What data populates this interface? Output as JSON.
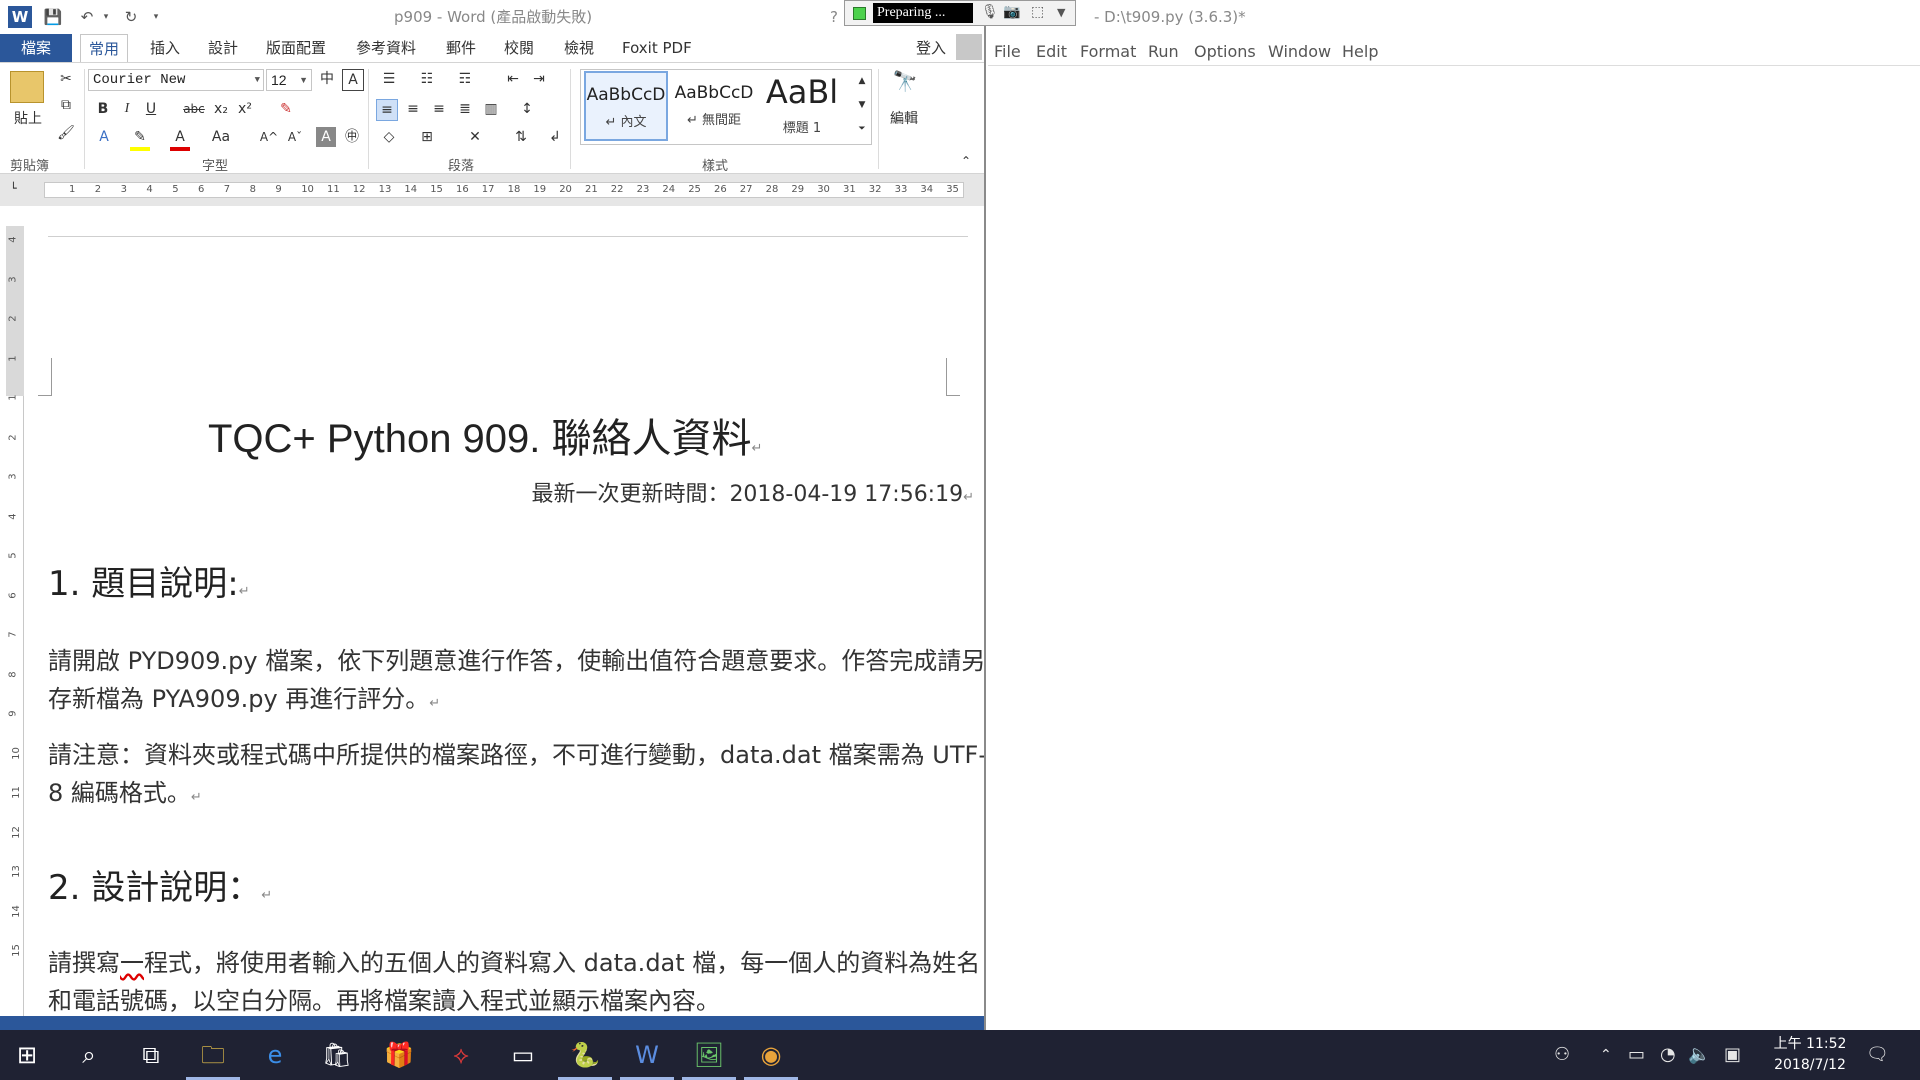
{
  "word": {
    "window_title": "p909 - Word (產品啟動失敗)",
    "help_glyph": "?",
    "tabs": [
      "檔案",
      "常用",
      "插入",
      "設計",
      "版面配置",
      "參考資料",
      "郵件",
      "校閱",
      "檢視",
      "Foxit PDF"
    ],
    "signin": "登入",
    "ribbon": {
      "paste_label": "貼上",
      "clipboard_label": "剪貼簿",
      "font_label": "字型",
      "paragraph_label": "段落",
      "styles_label": "樣式",
      "editing_label": "編輯",
      "font_name": "Courier New",
      "font_size": "12",
      "btn_bold": "B",
      "btn_italic": "I",
      "btn_underline": "U",
      "btn_strike": "abc",
      "btn_sub": "x₂",
      "btn_sup": "x²",
      "btn_font_color": "A",
      "btn_case": "Aa",
      "btn_grow": "A^",
      "btn_shrink": "Aˇ",
      "styles": [
        {
          "sample": "AaBbCcD",
          "name": "↵ 內文"
        },
        {
          "sample": "AaBbCcD",
          "name": "↵ 無間距"
        },
        {
          "sample": "AaBl",
          "name": "標題 1"
        }
      ]
    },
    "ruler_ticks": [
      "1",
      "2",
      "3",
      "4",
      "5",
      "6",
      "7",
      "8",
      "9",
      "10",
      "11",
      "12",
      "13",
      "14",
      "15",
      "16",
      "17",
      "18",
      "19",
      "20",
      "21",
      "22",
      "23",
      "24",
      "25",
      "26",
      "27",
      "28",
      "29",
      "30",
      "31",
      "32",
      "33",
      "34",
      "35"
    ],
    "vruler_ticks": [
      "4",
      "3",
      "2",
      "1",
      "1",
      "2",
      "3",
      "4",
      "5",
      "6",
      "7",
      "8",
      "9",
      "10",
      "11",
      "12",
      "13",
      "14",
      "15"
    ],
    "document": {
      "title": "TQC+ Python 909.  聯絡人資料",
      "updated": "最新一次更新時間：2018-04-19 17:56:19",
      "section1_heading": "1.  題目說明:",
      "section1_para1": "請開啟 PYD909.py 檔案，依下列題意進行作答，使輸出值符合題意要求。作答完成請另存新檔為 PYA909.py 再進行評分。",
      "section1_para2": "請注意：資料夾或程式碼中所提供的檔案路徑，不可進行變動，data.dat 檔案需為 UTF-8 編碼格式。",
      "section2_heading": "2.  設計說明：",
      "section2_para_pre": "請撰寫",
      "section2_para_err": "一",
      "section2_para_post": "程式，將使用者輸入的五個人的資料寫入 data.dat 檔，每一個人的資料為姓名和電話號碼，以空白分隔。再將檔案讀入程式並顯示檔案內容。",
      "para_mark": "↵"
    }
  },
  "recorder": {
    "status": "Preparing ...",
    "mic_icon": "🎙",
    "cam_icon": "📷",
    "region_icon": "⬚",
    "menu_icon": "▼"
  },
  "idle": {
    "window_title": "- D:\\t909.py (3.6.3)*",
    "menu": [
      "File",
      "Edit",
      "Format",
      "Run",
      "Options",
      "Window",
      "Help"
    ]
  },
  "taskbar": {
    "clock_time": "上午 11:52",
    "clock_date": "2018/7/12"
  },
  "colors": {
    "word_blue": "#2b579a",
    "taskbar": "#1f2233",
    "recorder_green": "#4cd14c"
  }
}
